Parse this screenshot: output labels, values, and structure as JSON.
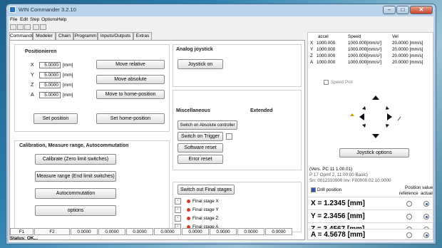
{
  "window": {
    "title": "WIN Commander 3.2.10"
  },
  "menu": [
    "File",
    "Edit",
    "Step",
    "Options",
    "Help"
  ],
  "tabs": [
    "Commands",
    "Modeler",
    "Chain",
    "Programm",
    "Inputs/Outputs",
    "Extras"
  ],
  "positions": {
    "label": "Positionieren",
    "axes": [
      {
        "name": "X",
        "value": "5.0000",
        "unit": "[mm]"
      },
      {
        "name": "Y",
        "value": "5.0000",
        "unit": "[mm]"
      },
      {
        "name": "Z",
        "value": "5.0000",
        "unit": "[mm]"
      },
      {
        "name": "A",
        "value": "5.0000",
        "unit": "[mm]"
      }
    ],
    "move_relative": "Move relative",
    "move_absolute": "Move absolute",
    "move_home": "Move to home-position",
    "set_position": "Set position",
    "set_home": "Set home-position"
  },
  "analog": {
    "label": "Analog joystick",
    "joystick_on": "Joystick on"
  },
  "misc": {
    "label": "Miscellaneous",
    "extended": "Extended",
    "switch_absolute": "Switch on Absolute controller",
    "switch_trigger": "Switch on Trigger",
    "software_reset": "Software reset",
    "error_reset": "Error reset"
  },
  "calibration": {
    "label": "Calibration, Measure range, Autocommutation",
    "calibrate": "Calibrate (Zero limit switches)",
    "measure": "Measure range (End limit switches)",
    "autocommutation": "Autocommutation",
    "options": "options"
  },
  "final_stages": {
    "switch_out": "Switch out Final stages",
    "items": [
      "Final stage X",
      "Final stage Y",
      "Final stage Z",
      "Final stage A"
    ]
  },
  "bottom": {
    "cells": [
      "F1",
      "F2",
      "0.0000",
      "0.0000",
      "0.0000",
      "0.0000",
      "0.0000",
      "0.0000",
      "0.0000",
      "0.0000"
    ]
  },
  "status": "Status: OK...",
  "speed_table": {
    "headers": [
      "accel",
      "Speed",
      "Vel"
    ],
    "rows": [
      {
        "axis": "X",
        "accel": "1000.000",
        "speed": "1000.000[mm/s²]",
        "vel": "20.0000 [mm/s]"
      },
      {
        "axis": "Y",
        "accel": "1000.000",
        "speed": "1000.000[mm/s²]",
        "vel": "20.0000 [mm/s]"
      },
      {
        "axis": "Z",
        "accel": "1000.000",
        "speed": "1000.000[mm/s²]",
        "vel": "20.0000 [mm/s]"
      },
      {
        "axis": "A",
        "accel": "1000.000",
        "speed": "1000.000[mm/s²]",
        "vel": "20.0000 [mm/s]"
      }
    ],
    "speed_poti": "Speed Poti"
  },
  "joystick_options": "Joystick options",
  "version": {
    "line1": "(Vers. PC 11 1.00.01)",
    "line2": "P 17 Opmf 2, 11:00:00 Basic)",
    "line3": "Sn: 0012310000 Inv: F00000.02.10.0000"
  },
  "position_display": {
    "checkbox_label": "Drill position",
    "position_value": "Position value",
    "reference": "reference",
    "actual": "actual",
    "rows": [
      {
        "label": "X = 1.2345 [mm]"
      },
      {
        "label": "Y = 2.3456 [mm]"
      },
      {
        "label": "Z = 3.4567 [mm]"
      },
      {
        "label": "A = 4.5678 [mm]"
      }
    ]
  }
}
